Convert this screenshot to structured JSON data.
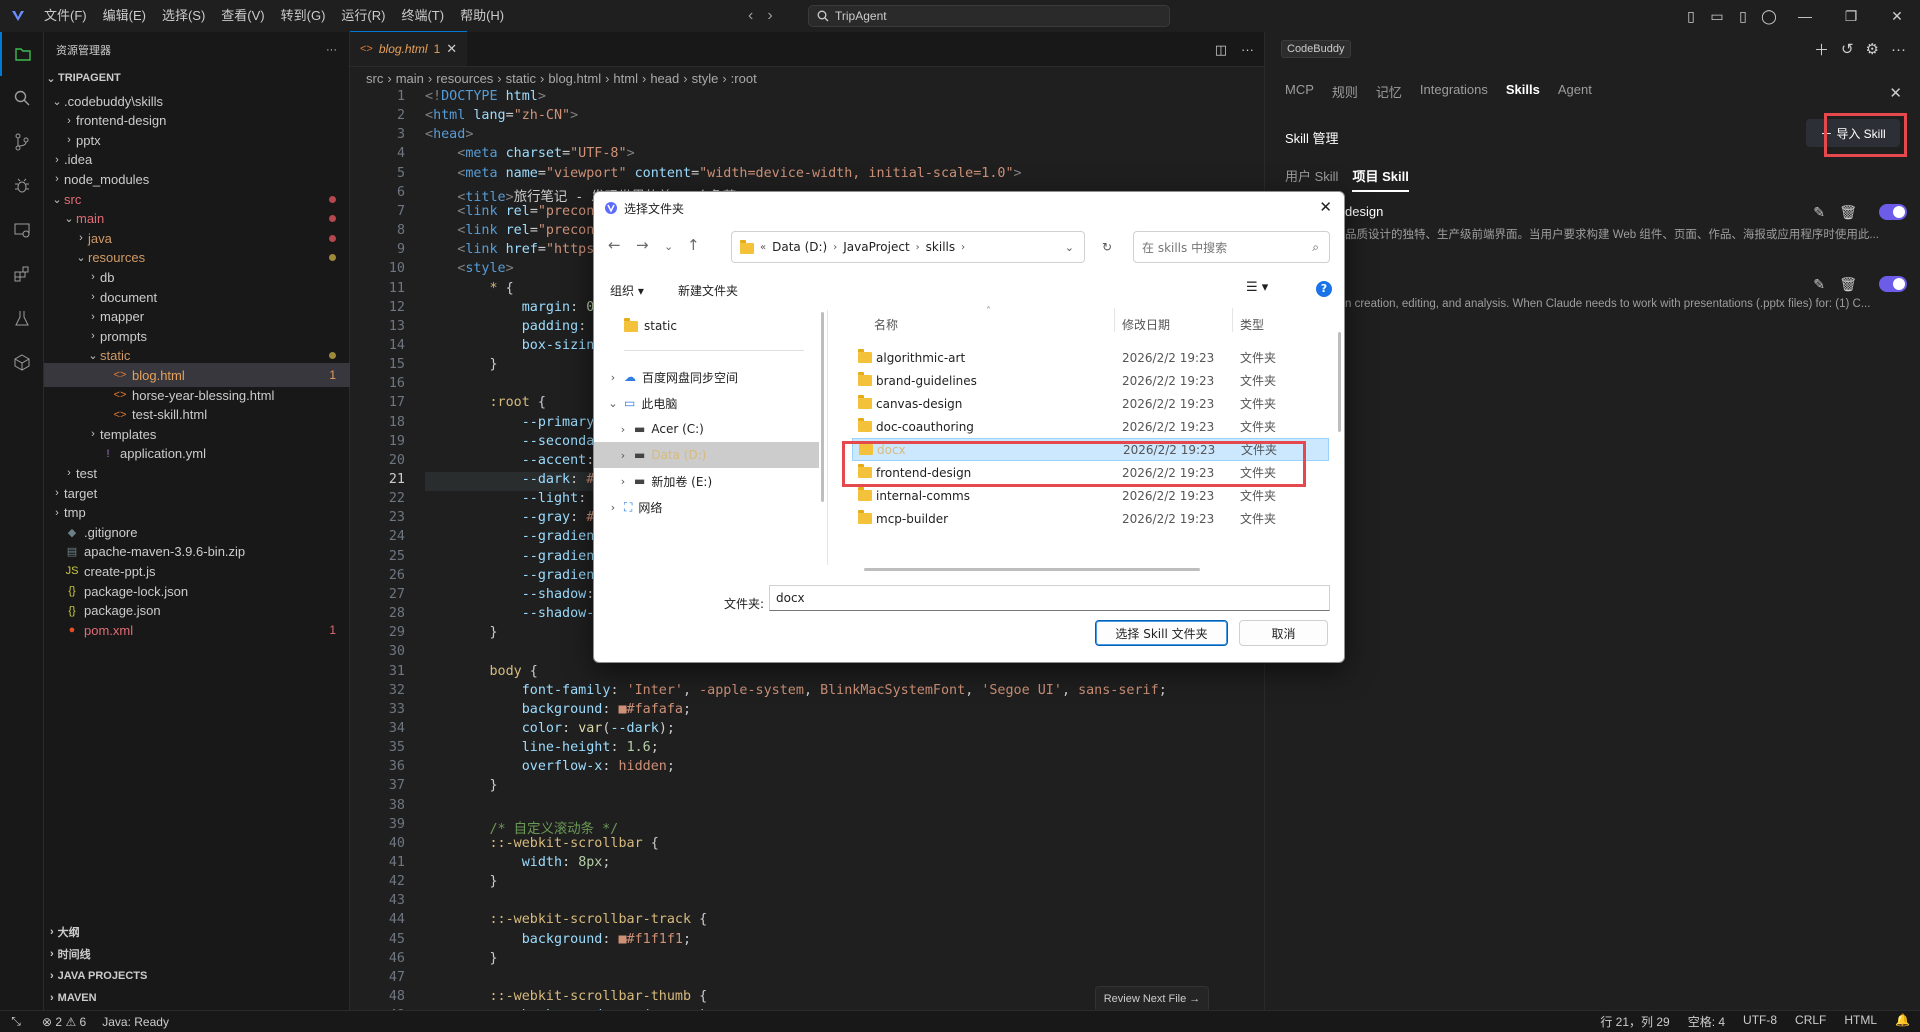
{
  "titlebar": {
    "menus": [
      "文件(F)",
      "编辑(E)",
      "选择(S)",
      "查看(V)",
      "转到(G)",
      "运行(R)",
      "终端(T)",
      "帮助(H)"
    ],
    "search": "TripAgent"
  },
  "explorer": {
    "title": "资源管理器",
    "more": "···",
    "project": "TRIPAGENT",
    "tree": [
      {
        "label": ".codebuddy\\skills",
        "depth": 1,
        "tw": "⌄",
        "icon": "",
        "color": "#cccccc"
      },
      {
        "label": "frontend-design",
        "depth": 2,
        "tw": "›",
        "icon": "",
        "color": "#cccccc"
      },
      {
        "label": "pptx",
        "depth": 2,
        "tw": "›",
        "icon": "",
        "color": "#cccccc"
      },
      {
        "label": ".idea",
        "depth": 1,
        "tw": "›",
        "icon": "",
        "color": "#cccccc"
      },
      {
        "label": "node_modules",
        "depth": 1,
        "tw": "›",
        "icon": "",
        "color": "#cccccc"
      },
      {
        "label": "src",
        "depth": 1,
        "tw": "⌄",
        "icon": "",
        "color": "#e06c75",
        "dot": "#b5484e"
      },
      {
        "label": "main",
        "depth": 2,
        "tw": "⌄",
        "icon": "",
        "color": "#e06c75",
        "dot": "#b5484e"
      },
      {
        "label": "java",
        "depth": 3,
        "tw": "›",
        "icon": "",
        "color": "#d19a66",
        "dot": "#b5484e"
      },
      {
        "label": "resources",
        "depth": 3,
        "tw": "⌄",
        "icon": "",
        "color": "#d19a66",
        "dot": "#9e8a3a"
      },
      {
        "label": "db",
        "depth": 4,
        "tw": "›",
        "icon": "",
        "color": "#cccccc"
      },
      {
        "label": "document",
        "depth": 4,
        "tw": "›",
        "icon": "",
        "color": "#cccccc"
      },
      {
        "label": "mapper",
        "depth": 4,
        "tw": "›",
        "icon": "",
        "color": "#cccccc"
      },
      {
        "label": "prompts",
        "depth": 4,
        "tw": "›",
        "icon": "",
        "color": "#cccccc"
      },
      {
        "label": "static",
        "depth": 4,
        "tw": "⌄",
        "icon": "",
        "color": "#d19a66",
        "dot": "#9e8a3a"
      },
      {
        "label": "blog.html",
        "depth": 5,
        "tw": "",
        "icon": "<>",
        "iconColor": "#e37933",
        "color": "#e5a05b",
        "count": "1",
        "selected": true
      },
      {
        "label": "horse-year-blessing.html",
        "depth": 5,
        "tw": "",
        "icon": "<>",
        "iconColor": "#e37933",
        "color": "#cccccc"
      },
      {
        "label": "test-skill.html",
        "depth": 5,
        "tw": "",
        "icon": "<>",
        "iconColor": "#e37933",
        "color": "#cccccc"
      },
      {
        "label": "templates",
        "depth": 4,
        "tw": "›",
        "icon": "",
        "color": "#cccccc"
      },
      {
        "label": "application.yml",
        "depth": 4,
        "tw": "",
        "icon": "!",
        "iconColor": "#a074c4",
        "color": "#cccccc"
      },
      {
        "label": "test",
        "depth": 2,
        "tw": "›",
        "icon": "",
        "color": "#cccccc"
      },
      {
        "label": "target",
        "depth": 1,
        "tw": "›",
        "icon": "",
        "color": "#cccccc"
      },
      {
        "label": "tmp",
        "depth": 1,
        "tw": "›",
        "icon": "",
        "color": "#cccccc"
      },
      {
        "label": ".gitignore",
        "depth": 1,
        "tw": "",
        "icon": "◆",
        "iconColor": "#6d8086",
        "color": "#cccccc"
      },
      {
        "label": "apache-maven-3.9.6-bin.zip",
        "depth": 1,
        "tw": "",
        "icon": "▤",
        "iconColor": "#6d8086",
        "color": "#cccccc"
      },
      {
        "label": "create-ppt.js",
        "depth": 1,
        "tw": "",
        "icon": "JS",
        "iconColor": "#cbcb41",
        "color": "#cccccc"
      },
      {
        "label": "package-lock.json",
        "depth": 1,
        "tw": "",
        "icon": "{}",
        "iconColor": "#cbcb41",
        "color": "#cccccc"
      },
      {
        "label": "package.json",
        "depth": 1,
        "tw": "",
        "icon": "{}",
        "iconColor": "#cbcb41",
        "color": "#cccccc"
      },
      {
        "label": "pom.xml",
        "depth": 1,
        "tw": "",
        "icon": "●",
        "iconColor": "#e44d26",
        "color": "#e06c75",
        "count": "1"
      }
    ],
    "sections": [
      "大纲",
      "时间线",
      "JAVA PROJECTS",
      "MAVEN"
    ]
  },
  "editor": {
    "tab": {
      "name": "blog.html",
      "count": "1"
    },
    "breadcrumb": [
      "src",
      "main",
      "resources",
      "static",
      "blog.html",
      "html",
      "head",
      "style",
      ":root"
    ],
    "review": "Review Next File"
  },
  "code_lines": [
    "<span class='df'>&lt;!</span><span class='tg'>DOCTYPE</span> <span class='at'>html</span><span class='df'>&gt;</span>",
    "<span class='df'>&lt;</span><span class='tg'>html</span> <span class='at'>lang</span>=<span class='st'>\"zh-CN\"</span><span class='df'>&gt;</span>",
    "<span class='df'>&lt;</span><span class='tg'>head</span><span class='df'>&gt;</span>",
    "    <span class='df'>&lt;</span><span class='tg'>meta</span> <span class='at'>charset</span>=<span class='st'>\"UTF-8\"</span><span class='df'>&gt;</span>",
    "    <span class='df'>&lt;</span><span class='tg'>meta</span> <span class='at'>name</span>=<span class='st'>\"viewport\"</span> <span class='at'>content</span>=<span class='st'>\"width=device-width, initial-scale=1.0\"</span><span class='df'>&gt;</span>",
    "    <span class='df'>&lt;</span><span class='tg'>title</span><span class='df'>&gt;</span>旅行笔记 - 发现世界的美 · 个角落<span class='df'>&lt;/</span><span class='tg'>title</span><span class='df'>&gt;</span>",
    "    <span class='df'>&lt;</span><span class='tg'>link</span> <span class='at'>rel</span>=<span class='st'>\"preconnect\"</span>",
    "    <span class='df'>&lt;</span><span class='tg'>link</span> <span class='at'>rel</span>=<span class='st'>\"preconnect\"</span>",
    "    <span class='df'>&lt;</span><span class='tg'>link</span> <span class='at'>href</span>=<span class='st'>\"https:</span>",
    "    <span class='df'>&lt;</span><span class='tg'>style</span><span class='df'>&gt;</span>",
    "        <span class='sel'>*</span> {",
    "            <span class='pr'>margin</span>: <span class='nu'>0</span>;",
    "            <span class='pr'>padding</span>: <span class='nu'>0</span>;",
    "            <span class='pr'>box-sizing</span>: <span class='vl'>border-box</span>;",
    "        }",
    "",
    "        <span class='sel'>:root</span> {",
    "            <span class='pr'>--primary</span>: <span class='vl'>#2d6a4f</span>;",
    "            <span class='pr'>--secondary</span>: <span class='vl'>#40916c</span>;",
    "            <span class='pr'>--accent</span>: <span class='vl'>#f4a261</span>;",
    "            <span class='pr'>--dark</span>: <span class='vl'>#1b1b1b</span>;",
    "            <span class='pr'>--light</span>: <span class='vl'>#fafafa</span>;",
    "            <span class='pr'>--gray</span>: <span class='vl'>#6b7280</span>;",
    "            <span class='pr'>--gradient</span>",
    "            <span class='pr'>--gradient</span>",
    "            <span class='pr'>--gradient</span>",
    "            <span class='pr'>--shadow</span>:",
    "            <span class='pr'>--shadow-h</span>",
    "        }",
    "",
    "        <span class='sel'>body</span> {",
    "            <span class='pr'>font-family</span>: <span class='st'>'Inter'</span>, <span class='vl'>-apple-system</span>, <span class='vl'>BlinkMacSystemFont</span>, <span class='st'>'Segoe UI'</span>, <span class='vl'>sans-serif</span>;",
    "            <span class='pr'>background</span>: <span class='vl'>■#fafafa</span>;",
    "            <span class='pr'>color</span>: <span class='fn'>var</span>(<span class='pr'>--dark</span>);",
    "            <span class='pr'>line-height</span>: <span class='nu'>1.6</span>;",
    "            <span class='pr'>overflow-x</span>: <span class='vl'>hidden</span>;",
    "        }",
    "",
    "        <span class='cm'>/* 自定义滚动条 */</span>",
    "        <span class='sel'>::-webkit-scrollbar</span> {",
    "            <span class='pr'>width</span>: <span class='nu'>8px</span>;",
    "        }",
    "",
    "        <span class='sel'>::-webkit-scrollbar-track</span> {",
    "            <span class='pr'>background</span>: <span class='vl'>■#f1f1f1</span>;",
    "        }",
    "",
    "        <span class='sel'>::-webkit-scrollbar-thumb</span> {",
    "            <span class='pr'>background</span>: <span class='fn'>var</span>(<span class='pr'>--gray</span>);"
  ],
  "panel": {
    "badge": "CodeBuddy",
    "tabs": [
      "MCP",
      "规则",
      "记忆",
      "Integrations",
      "Skills",
      "Agent"
    ],
    "active_tab": "Skills",
    "skill_title": "Skill 管理",
    "import_label": "导入 Skill",
    "subtabs": [
      "用户 Skill",
      "项目 Skill"
    ],
    "active_subtab": "项目 Skill",
    "skills": [
      {
        "name": "design",
        "desc": "品质设计的独特、生产级前端界面。当用户要求构建 Web 组件、页面、作品、海报或应用程序时使用此..."
      },
      {
        "name": "",
        "desc": "n creation, editing, and analysis. When Claude needs to work with presentations (.pptx files) for: (1) C..."
      }
    ]
  },
  "status": {
    "errors": "2",
    "warnings": "6",
    "java": "Java: Ready",
    "position": "行 21，列 29",
    "spaces": "空格: 4",
    "encoding": "UTF-8",
    "eol": "CRLF",
    "language": "HTML"
  },
  "dialog": {
    "title": "选择文件夹",
    "address": [
      "Data (D:)",
      "JavaProject",
      "skills"
    ],
    "search_placeholder": "在 skills 中搜索",
    "toolbar": {
      "organize": "组织 ▾",
      "new_folder": "新建文件夹"
    },
    "left_tree": [
      {
        "label": "static",
        "kind": "folder",
        "indent": 30
      },
      {
        "label": "百度网盘同步空间",
        "kind": "cloud",
        "indent": 30,
        "tw": "›"
      },
      {
        "label": "此电脑",
        "kind": "pc",
        "indent": 30,
        "tw": "⌄"
      },
      {
        "label": "Acer (C:)",
        "kind": "drive",
        "indent": 40,
        "tw": "›"
      },
      {
        "label": "Data (D:)",
        "kind": "drive",
        "indent": 40,
        "tw": "›",
        "selected": true
      },
      {
        "label": "新加卷 (E:)",
        "kind": "drive",
        "indent": 40,
        "tw": "›"
      },
      {
        "label": "网络",
        "kind": "net",
        "indent": 30,
        "tw": "›"
      }
    ],
    "columns": [
      "名称",
      "修改日期",
      "类型"
    ],
    "files": [
      {
        "name": "algorithmic-art",
        "date": "2026/2/2 19:23",
        "type": "文件夹"
      },
      {
        "name": "brand-guidelines",
        "date": "2026/2/2 19:23",
        "type": "文件夹"
      },
      {
        "name": "canvas-design",
        "date": "2026/2/2 19:23",
        "type": "文件夹"
      },
      {
        "name": "doc-coauthoring",
        "date": "2026/2/2 19:23",
        "type": "文件夹"
      },
      {
        "name": "docx",
        "date": "2026/2/2 19:23",
        "type": "文件夹",
        "selected": true
      },
      {
        "name": "frontend-design",
        "date": "2026/2/2 19:23",
        "type": "文件夹"
      },
      {
        "name": "internal-comms",
        "date": "2026/2/2 19:23",
        "type": "文件夹"
      },
      {
        "name": "mcp-builder",
        "date": "2026/2/2 19:23",
        "type": "文件夹"
      }
    ],
    "folder_label": "文件夹:",
    "folder_value": "docx",
    "ok": "选择 Skill 文件夹",
    "cancel": "取消"
  }
}
